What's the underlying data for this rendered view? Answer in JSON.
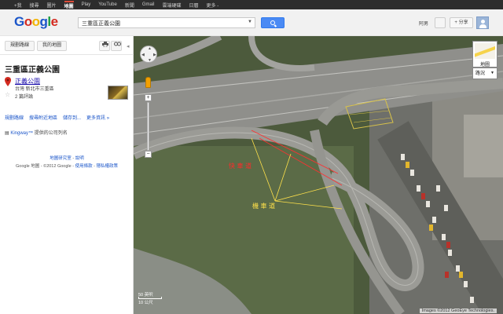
{
  "topbar": {
    "items": [
      "+我",
      "搜尋",
      "圖片",
      "地圖",
      "Play",
      "YouTube",
      "新聞",
      "Gmail",
      "雲端硬碟",
      "日曆",
      "更多 -"
    ],
    "active_index": 3
  },
  "header": {
    "logo": "Google",
    "search_value": "三重區正義公園",
    "user_name": "阿男",
    "share_label": "+ 分享"
  },
  "panel": {
    "get_directions_label": "規劃路線",
    "my_places_label": "我的地圖",
    "title": "三重區正義公園",
    "place_name": "正義公園",
    "place_address": "台灣 新北市三重區",
    "reviews": "2 篇評論",
    "actions": [
      "規劃路線",
      "搜尋附近地區",
      "儲存到...",
      "更多資訊 »"
    ],
    "provider_brand": "Kingway™",
    "provider_text": "提供的公司列名",
    "footer_links": [
      "地圖研究室",
      "說明"
    ],
    "footer_copy": "Google 地圖 - ©2012 Google -",
    "footer_copy_links": [
      "使用條款",
      "隱私權政策"
    ]
  },
  "map": {
    "map_type_label": "地圖",
    "traffic_label": "路況",
    "annotation_red": "快 車 道",
    "annotation_yellow": "機 車 道",
    "scale_top": "50 英呎",
    "scale_bottom": "10 公尺",
    "attribution": "Images ©2012 GeoEye Technologies."
  },
  "colors": {
    "accent_blue": "#4a8af4",
    "link_blue": "#1a55c9",
    "marker_red": "#d42b20",
    "annotation_red": "#ff2a2a",
    "annotation_yellow": "#ffe14a"
  }
}
